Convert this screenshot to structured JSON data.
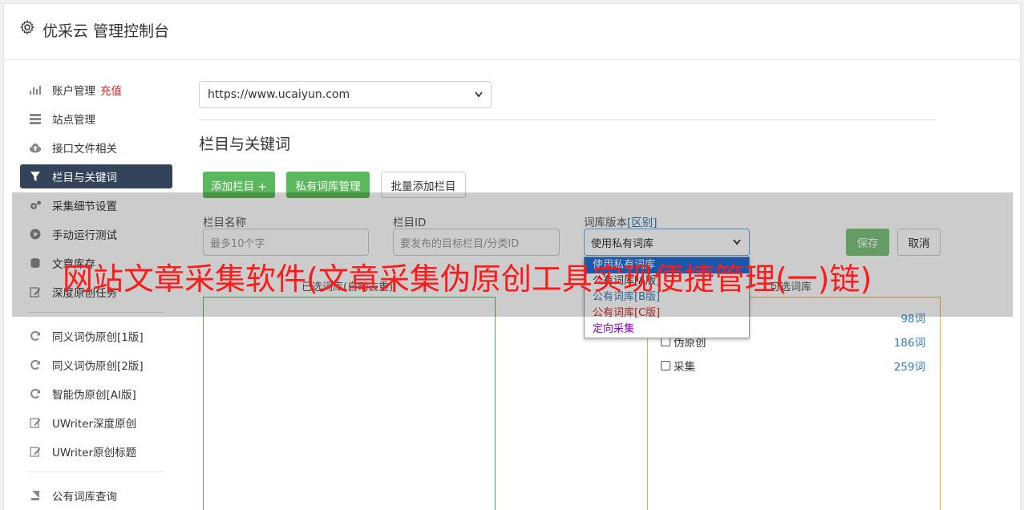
{
  "header": {
    "title": "优采云 管理控制台",
    "icon": "gear-icon"
  },
  "sidebar": {
    "items": [
      {
        "label": "账户管理",
        "badge": "充值",
        "icon": "bar-chart-icon"
      },
      {
        "label": "站点管理",
        "icon": "server-icon"
      },
      {
        "label": "接口文件相关",
        "icon": "cloud-upload-icon"
      },
      {
        "label": "栏目与关键词",
        "icon": "filter-icon",
        "active": true
      },
      {
        "label": "采集细节设置",
        "icon": "cogs-icon"
      },
      {
        "label": "手动运行测试",
        "icon": "play-icon"
      },
      {
        "label": "文章库存",
        "icon": "database-icon"
      },
      {
        "label": "深度原创任务",
        "icon": "edit-icon"
      }
    ],
    "items2": [
      {
        "label": "同义词伪原创[1版]",
        "icon": "refresh-icon"
      },
      {
        "label": "同义词伪原创[2版]",
        "icon": "refresh-icon"
      },
      {
        "label": "智能伪原创[AI版]",
        "icon": "refresh-icon"
      },
      {
        "label": "UWriter深度原创",
        "icon": "edit-icon"
      },
      {
        "label": "UWriter原创标题",
        "icon": "edit-icon"
      }
    ],
    "items3": [
      {
        "label": "公有词库查询",
        "icon": "book-icon"
      }
    ]
  },
  "main": {
    "site_select": "https://www.ucaiyun.com",
    "section_title": "栏目与关键词",
    "buttons": {
      "add_column": "添加栏目 +",
      "private_lib": "私有词库管理",
      "batch_add": "批量添加栏目"
    },
    "fields": {
      "column_name_label": "栏目名称",
      "column_name_placeholder": "最多10个字",
      "column_id_label": "栏目ID",
      "column_id_placeholder": "要发布的目标栏目/分类ID",
      "lib_version_label": "词库版本",
      "lib_version_link": "[区别]",
      "lib_version_value": "使用私有词库"
    },
    "save": "保存",
    "cancel": "取消",
    "left_box_label": "已选词库(自动去重)",
    "right_box_label": "可选词库",
    "dropdown_options": [
      {
        "label": "使用私有词库",
        "color": "#ffffff",
        "selected": true
      },
      {
        "label": "公有词库[A版]",
        "color": "#333333"
      },
      {
        "label": "公有词库[B版]",
        "color": "#337ab7"
      },
      {
        "label": "公有词库[C版]",
        "color": "#c9302c"
      },
      {
        "label": "定向采集",
        "color": "#8a00c2"
      }
    ],
    "library_rows": [
      {
        "label": "",
        "count": "98词"
      },
      {
        "label": "伪原创",
        "count": "186词"
      },
      {
        "label": "采集",
        "count": "259词"
      }
    ]
  },
  "overlay": {
    "text": "网站文章采集软件(文章采集伪原创工具实现便捷管理(一)链)"
  }
}
